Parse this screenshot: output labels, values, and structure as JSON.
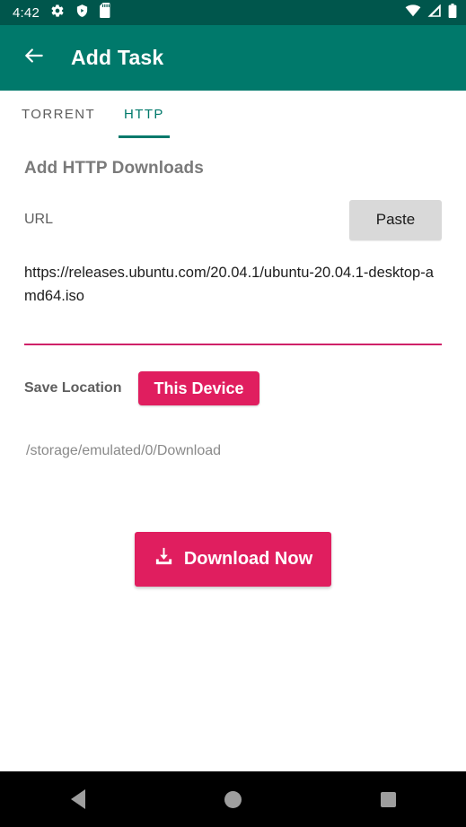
{
  "status_bar": {
    "time": "4:42",
    "left_icons": [
      "gear-icon",
      "shield-play-icon",
      "sd-card-icon"
    ],
    "right_icons": [
      "wifi-icon",
      "cellular-signal-icon",
      "battery-icon"
    ],
    "background_color": "#00564c"
  },
  "app_bar": {
    "back_icon": "arrow-left-icon",
    "title": "Add Task",
    "background_color": "#00796b"
  },
  "tabs": [
    {
      "label": "TORRENT",
      "active": false
    },
    {
      "label": "HTTP",
      "active": true
    }
  ],
  "main": {
    "section_title": "Add HTTP Downloads",
    "url_label": "URL",
    "paste_button": "Paste",
    "url_value": "https://releases.ubuntu.com/20.04.1/ubuntu-20.04.1-desktop-amd64.iso",
    "url_underline_color": "#cf2168",
    "save_location_label": "Save Location",
    "save_location_button": "This Device",
    "save_path": "/storage/emulated/0/Download",
    "download_button": "Download Now",
    "download_button_icon": "download-icon",
    "accent_color": "#e01e5f"
  },
  "nav_bar": {
    "back": "back-triangle-icon",
    "home": "home-circle-icon",
    "recents": "recents-square-icon"
  }
}
